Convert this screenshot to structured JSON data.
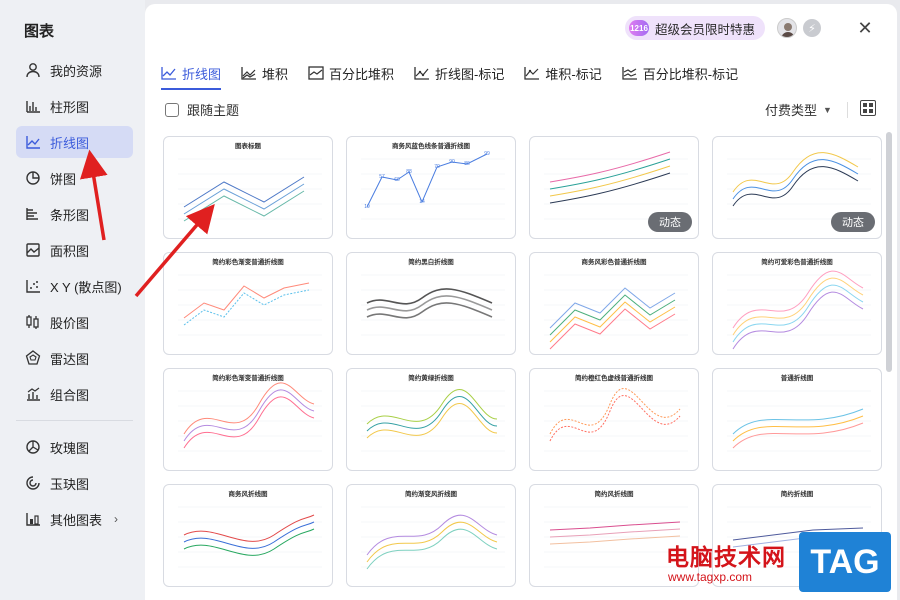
{
  "sidebar": {
    "title": "图表",
    "items": [
      {
        "label": "我的资源",
        "icon": "user-icon"
      },
      {
        "label": "柱形图",
        "icon": "column-chart-icon"
      },
      {
        "label": "折线图",
        "icon": "line-chart-icon"
      },
      {
        "label": "饼图",
        "icon": "pie-chart-icon"
      },
      {
        "label": "条形图",
        "icon": "bar-chart-icon"
      },
      {
        "label": "面积图",
        "icon": "area-chart-icon"
      },
      {
        "label": "X Y (散点图)",
        "icon": "scatter-chart-icon"
      },
      {
        "label": "股价图",
        "icon": "stock-chart-icon"
      },
      {
        "label": "雷达图",
        "icon": "radar-chart-icon"
      },
      {
        "label": "组合图",
        "icon": "combo-chart-icon"
      }
    ],
    "items2": [
      {
        "label": "玫瑰图",
        "icon": "rose-chart-icon"
      },
      {
        "label": "玉玦图",
        "icon": "ring-chart-icon"
      },
      {
        "label": "其他图表",
        "icon": "other-chart-icon"
      }
    ],
    "active": "折线图"
  },
  "header": {
    "vip_badge_icon_text": "1216",
    "vip_badge": "超级会员限时特惠",
    "close_glyph": "✕"
  },
  "tabs": [
    {
      "label": "折线图",
      "active": true
    },
    {
      "label": "堆积",
      "active": false
    },
    {
      "label": "百分比堆积",
      "active": false
    },
    {
      "label": "折线图-标记",
      "active": false
    },
    {
      "label": "堆积-标记",
      "active": false
    },
    {
      "label": "百分比堆积-标记",
      "active": false
    }
  ],
  "toolbar": {
    "follow_theme": "跟随主题",
    "pay_type": "付费类型"
  },
  "templates": [
    {
      "title": "图表标题",
      "badge": ""
    },
    {
      "title": "商务风蓝色线条普通折线图",
      "badge": "",
      "labels": [
        "19",
        "57",
        "60",
        "88",
        "14",
        "70",
        "90",
        "86",
        "99"
      ]
    },
    {
      "title": "",
      "badge": "动态"
    },
    {
      "title": "",
      "badge": "动态"
    },
    {
      "title": "简约彩色渐变普通折线图",
      "badge": ""
    },
    {
      "title": "简约黑白折线图",
      "badge": ""
    },
    {
      "title": "商务风彩色普通折线图",
      "badge": ""
    },
    {
      "title": "简约可爱彩色普通折线图",
      "badge": ""
    },
    {
      "title": "简约彩色渐变普通折线图",
      "badge": ""
    },
    {
      "title": "简约黄绿折线图",
      "badge": ""
    },
    {
      "title": "简约橙红色虚线普通折线图",
      "badge": ""
    },
    {
      "title": "普通折线图",
      "badge": ""
    },
    {
      "title": "商务风折线图",
      "badge": ""
    },
    {
      "title": "简约渐变风折线图",
      "badge": ""
    },
    {
      "title": "简约风折线图",
      "badge": ""
    },
    {
      "title": "简约折线图",
      "badge": ""
    }
  ],
  "watermark": {
    "text": "电脑技术网",
    "url": "www.tagxp.com",
    "tag": "TAG"
  },
  "colors": {
    "accent": "#3b5bdb",
    "active_bg": "#d5dbf5",
    "arrow": "#e02020"
  }
}
